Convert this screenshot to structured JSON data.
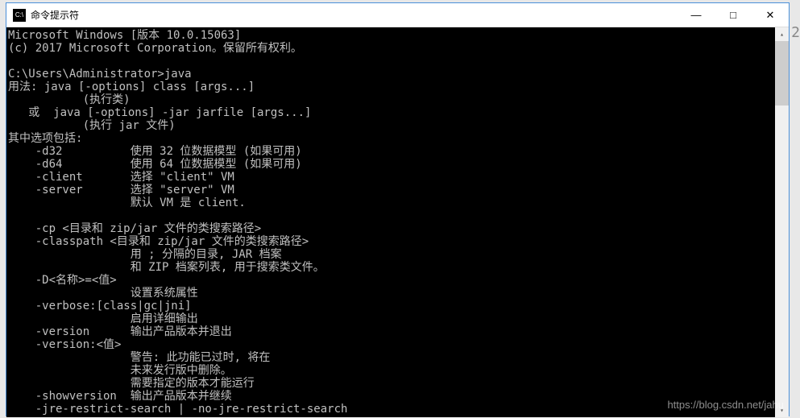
{
  "window": {
    "title": "命令提示符",
    "icon_label": "C:\\"
  },
  "controls": {
    "minimize": "—",
    "maximize": "□",
    "close": "✕"
  },
  "terminal": {
    "lines": [
      "Microsoft Windows [版本 10.0.15063]",
      "(c) 2017 Microsoft Corporation。保留所有权利。",
      "",
      "C:\\Users\\Administrator>java",
      "用法: java [-options] class [args...]",
      "           (执行类)",
      "   或  java [-options] -jar jarfile [args...]",
      "           (执行 jar 文件)",
      "其中选项包括:",
      "    -d32          使用 32 位数据模型 (如果可用)",
      "    -d64          使用 64 位数据模型 (如果可用)",
      "    -client       选择 \"client\" VM",
      "    -server       选择 \"server\" VM",
      "                  默认 VM 是 client.",
      "",
      "    -cp <目录和 zip/jar 文件的类搜索路径>",
      "    -classpath <目录和 zip/jar 文件的类搜索路径>",
      "                  用 ; 分隔的目录, JAR 档案",
      "                  和 ZIP 档案列表, 用于搜索类文件。",
      "    -D<名称>=<值>",
      "                  设置系统属性",
      "    -verbose:[class|gc|jni]",
      "                  启用详细输出",
      "    -version      输出产品版本并退出",
      "    -version:<值>",
      "                  警告: 此功能已过时, 将在",
      "                  未来发行版中删除。",
      "                  需要指定的版本才能运行",
      "    -showversion  输出产品版本并继续",
      "    -jre-restrict-search | -no-jre-restrict-search"
    ]
  },
  "watermark": "https://blog.csdn.net/jahu",
  "bg_number": "2"
}
